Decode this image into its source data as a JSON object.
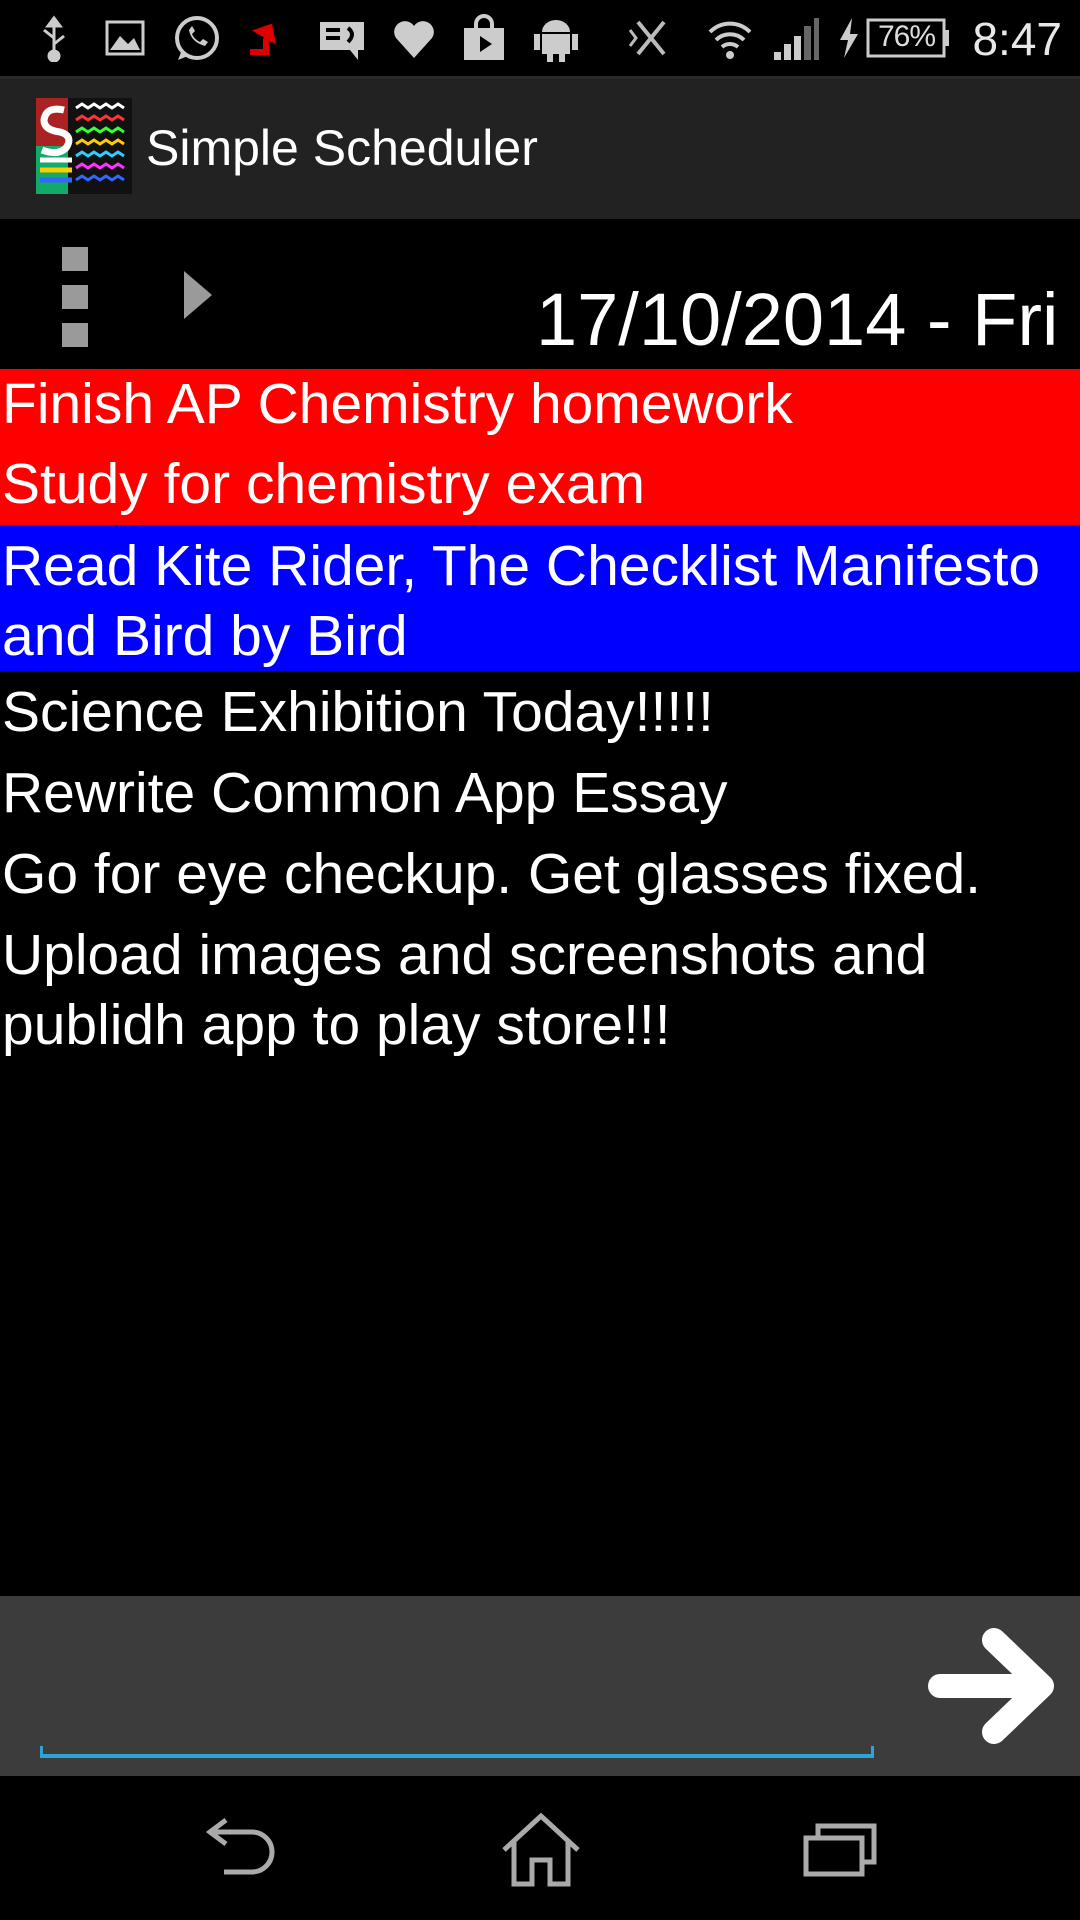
{
  "status_bar": {
    "battery_percent": "76%",
    "time": "8:47",
    "icons": [
      "usb-icon",
      "image-icon",
      "whatsapp-icon",
      "upload-icon",
      "message-icon",
      "heart-icon",
      "shopping-bag-icon",
      "android-icon",
      "nfc-off-icon",
      "wifi-icon",
      "signal-icon",
      "charging-icon",
      "battery-icon"
    ]
  },
  "action_bar": {
    "app_title": "Simple Scheduler"
  },
  "toolbar": {
    "date": "17/10/2014 - Fri"
  },
  "tasks": [
    {
      "text": "Finish AP Chemistry homework",
      "color": "#ff0000"
    },
    {
      "text": "Study for chemistry exam",
      "color": "#ff0000"
    },
    {
      "text": "Read Kite Rider, The Checklist Manifesto and Bird by Bird",
      "color": "#0000ff"
    },
    {
      "text": "Science Exhibition Today!!!!!",
      "color": "#000000"
    },
    {
      "text": "Rewrite Common App Essay",
      "color": "#000000"
    },
    {
      "text": "Go for eye checkup. Get glasses fixed.",
      "color": "#000000"
    },
    {
      "text": "Upload images and screenshots and publidh app to play store!!!",
      "color": "#000000"
    }
  ],
  "input": {
    "value": "",
    "accent_color": "#2ea3d6"
  },
  "nav_bar": {
    "buttons": [
      "back-icon",
      "home-icon",
      "recent-apps-icon"
    ]
  }
}
